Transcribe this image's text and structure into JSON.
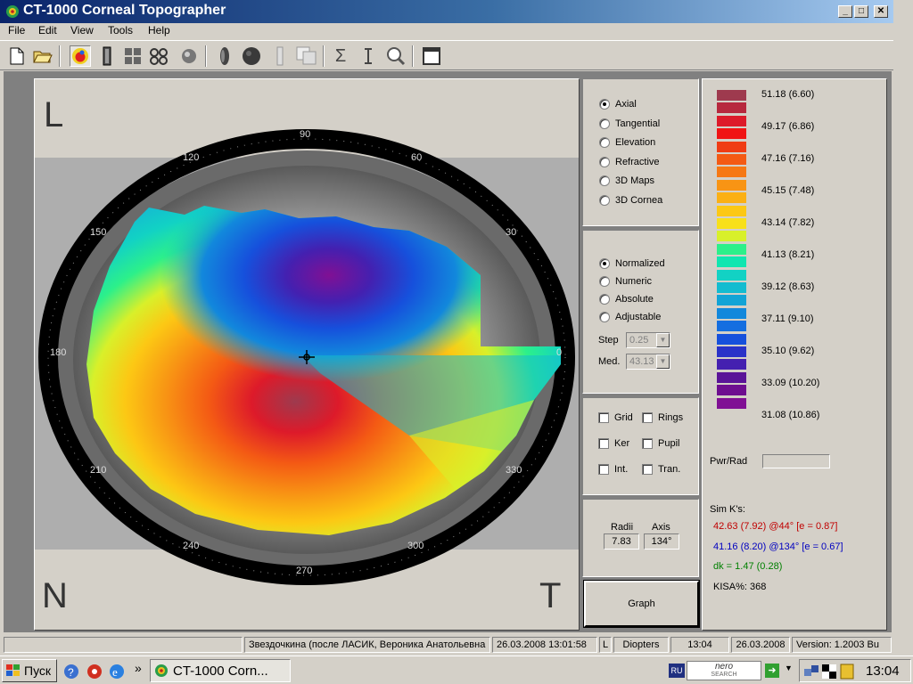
{
  "window": {
    "title": "CT-1000 Corneal Topographer",
    "controls": [
      "_",
      "□",
      "✕"
    ]
  },
  "menu": [
    "File",
    "Edit",
    "View",
    "Tools",
    "Help"
  ],
  "map": {
    "eye_letter": "L",
    "nasal_label": "N",
    "temporal_label": "T",
    "angle_labels": [
      "90",
      "120",
      "60",
      "150",
      "30",
      "180",
      "0",
      "210",
      "330",
      "240",
      "300",
      "270"
    ]
  },
  "map_type": {
    "selected": "Axial",
    "options": [
      "Axial",
      "Tangential",
      "Elevation",
      "Refractive",
      "3D Maps",
      "3D Cornea"
    ]
  },
  "scale": {
    "selected": "Normalized",
    "options": [
      "Normalized",
      "Numeric",
      "Absolute",
      "Adjustable"
    ],
    "step_label": "Step",
    "step_value": "0.25",
    "med_label": "Med.",
    "med_value": "43.13"
  },
  "overlays": {
    "grid": "Grid",
    "rings": "Rings",
    "ker": "Ker",
    "pupil": "Pupil",
    "int": "Int.",
    "tran": "Tran."
  },
  "cursor": {
    "radii_label": "Radii",
    "axis_label": "Axis",
    "radii_value": "7.83",
    "axis_value": "134°"
  },
  "graph_button": "Graph",
  "legend": {
    "colors": [
      "#9e3a4e",
      "#b7283e",
      "#dd1a2a",
      "#f01414",
      "#f03c14",
      "#f45a14",
      "#f67814",
      "#f89414",
      "#fbb014",
      "#fcc814",
      "#f8e01a",
      "#d8f02a",
      "#2cf08a",
      "#10e6b0",
      "#12d2c4",
      "#14bcd0",
      "#12a4d6",
      "#1288dc",
      "#146ee0",
      "#1650dc",
      "#2a32c8",
      "#4420b0",
      "#5a1498",
      "#6e0e90",
      "#801094"
    ],
    "labels": [
      "51.18 (6.60)",
      "49.17 (6.86)",
      "47.16 (7.16)",
      "45.15 (7.48)",
      "43.14 (7.82)",
      "41.13 (8.21)",
      "39.12 (8.63)",
      "37.11 (9.10)",
      "35.10 (9.62)",
      "33.09 (10.20)",
      "31.08 (10.86)"
    ]
  },
  "pwr_rad_label": "Pwr/Rad",
  "simk": {
    "title": "Sim K's:",
    "steep": "42.63 (7.92) @44° [e = 0.87]",
    "flat": "41.16 (8.20) @134° [e = 0.67]",
    "dk": "dk = 1.47 (0.28)",
    "kisa": "KISA%: 368",
    "steep_color": "#c00000",
    "flat_color": "#0000c0",
    "dk_color": "#008000"
  },
  "status": {
    "patient": "Звездочкина (после ЛАСИК, Вероника Анатольевна",
    "exam_datetime": "26.03.2008 13:01:58",
    "eye": "L",
    "units": "Diopters",
    "time": "13:04",
    "date": "26.03.2008",
    "version": "Version: 1.2003  Bu"
  },
  "taskbar": {
    "start": "Пуск",
    "chevron": "»",
    "window_button": "CT-1000 Corn...",
    "lang": "RU",
    "search_brand": "nero",
    "search_sub": "SEARCH",
    "clock": "13:04"
  }
}
